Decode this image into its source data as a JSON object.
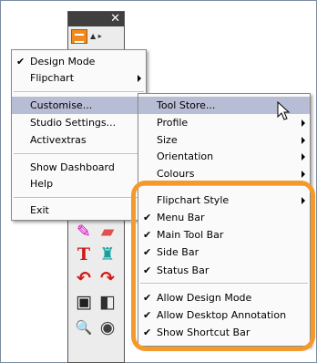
{
  "menu_main": {
    "items": [
      {
        "label": "Design Mode",
        "checked": true,
        "submenu": false
      },
      {
        "label": "Flipchart",
        "checked": false,
        "submenu": true
      },
      {
        "label": "Customise...",
        "checked": false,
        "submenu": true,
        "selected": true
      },
      {
        "label": "Studio Settings...",
        "checked": false,
        "submenu": false
      },
      {
        "label": "Activextras",
        "checked": false,
        "submenu": true
      },
      {
        "label": "Show Dashboard",
        "checked": false,
        "submenu": false
      },
      {
        "label": "Help",
        "checked": false,
        "submenu": true
      },
      {
        "label": "Exit",
        "checked": false,
        "submenu": false
      }
    ]
  },
  "menu_customise": {
    "items": [
      {
        "label": "Tool Store...",
        "checked": false,
        "submenu": false,
        "selected": true
      },
      {
        "label": "Profile",
        "checked": false,
        "submenu": true
      },
      {
        "label": "Size",
        "checked": false,
        "submenu": true
      },
      {
        "label": "Orientation",
        "checked": false,
        "submenu": true
      },
      {
        "label": "Colours",
        "checked": false,
        "submenu": true
      },
      {
        "label": "Flipchart Style",
        "checked": false,
        "submenu": true
      },
      {
        "label": "Menu Bar",
        "checked": true,
        "submenu": false
      },
      {
        "label": "Main Tool Bar",
        "checked": true,
        "submenu": false
      },
      {
        "label": "Side Bar",
        "checked": true,
        "submenu": false
      },
      {
        "label": "Status Bar",
        "checked": true,
        "submenu": false
      },
      {
        "label": "Allow Design Mode",
        "checked": true,
        "submenu": false
      },
      {
        "label": "Allow Desktop Annotation",
        "checked": true,
        "submenu": false
      },
      {
        "label": "Show Shortcut Bar",
        "checked": true,
        "submenu": false
      }
    ]
  },
  "toolbar": {
    "close_glyph": "✕",
    "tools": [
      {
        "icon": "pen-icon",
        "glyph": "✎",
        "color": "#d800c8"
      },
      {
        "icon": "eraser-icon",
        "glyph": "▰",
        "color": "#e05050"
      },
      {
        "icon": "text-icon",
        "glyph": "T",
        "color": "#d01818"
      },
      {
        "icon": "fill-icon",
        "glyph": "♜",
        "color": "#18a0a0"
      },
      {
        "icon": "undo-icon",
        "glyph": "↶",
        "color": "#d01818"
      },
      {
        "icon": "redo-icon",
        "glyph": "↷",
        "color": "#d01818"
      },
      {
        "icon": "screen-icon",
        "glyph": "▣",
        "color": "#202020"
      },
      {
        "icon": "spotlight-icon",
        "glyph": "◧",
        "color": "#303030"
      },
      {
        "icon": "magnifier-icon",
        "glyph": "🔍",
        "color": "#404040"
      },
      {
        "icon": "camera-icon",
        "glyph": "◉",
        "color": "#404040"
      }
    ]
  },
  "colors": {
    "highlight": "#f39a2b",
    "selection": "#b8bdd6"
  }
}
